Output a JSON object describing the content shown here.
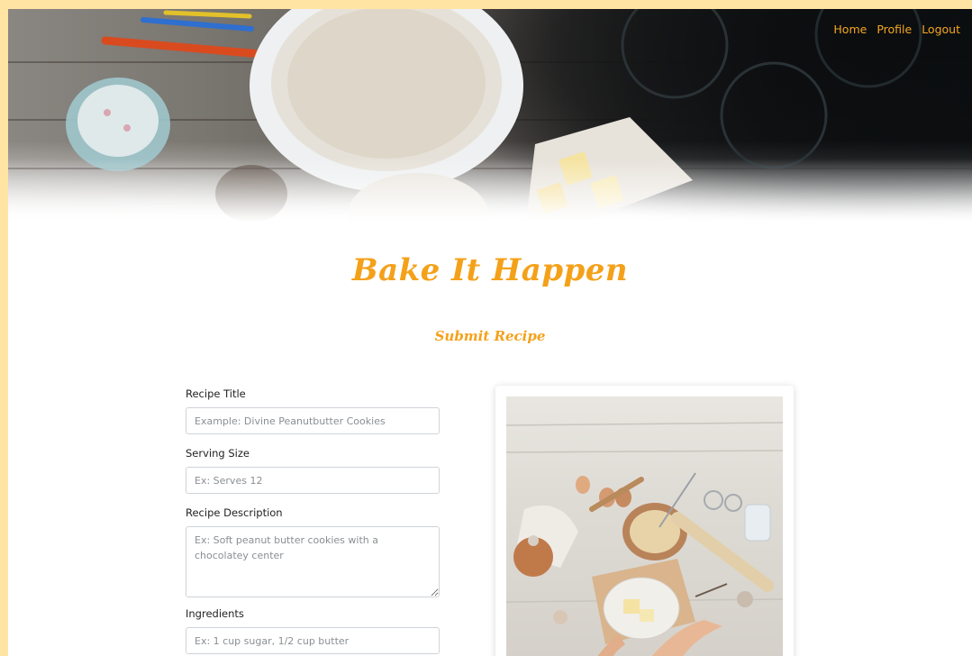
{
  "nav": {
    "home": "Home",
    "profile": "Profile",
    "logout": "Logout"
  },
  "brand": "Bake It Happen",
  "page_title": "Submit Recipe",
  "form": {
    "title": {
      "label": "Recipe Title",
      "placeholder": "Example: Divine Peanutbutter Cookies",
      "value": ""
    },
    "serving": {
      "label": "Serving Size",
      "placeholder": "Ex: Serves 12",
      "value": ""
    },
    "description": {
      "label": "Recipe Description",
      "placeholder": "Ex: Soft peanut butter cookies with a chocolatey center",
      "value": ""
    },
    "ingredients": {
      "label": "Ingredients",
      "placeholder": "Ex: 1 cup sugar, 1/2 cup butter",
      "value": ""
    }
  },
  "colors": {
    "accent": "#f4a11a",
    "nav_link": "#f5a623",
    "page_border": "#ffe4a3"
  },
  "images": {
    "hero": "baking-table-banner-image",
    "card": "baking-ingredients-photo"
  }
}
